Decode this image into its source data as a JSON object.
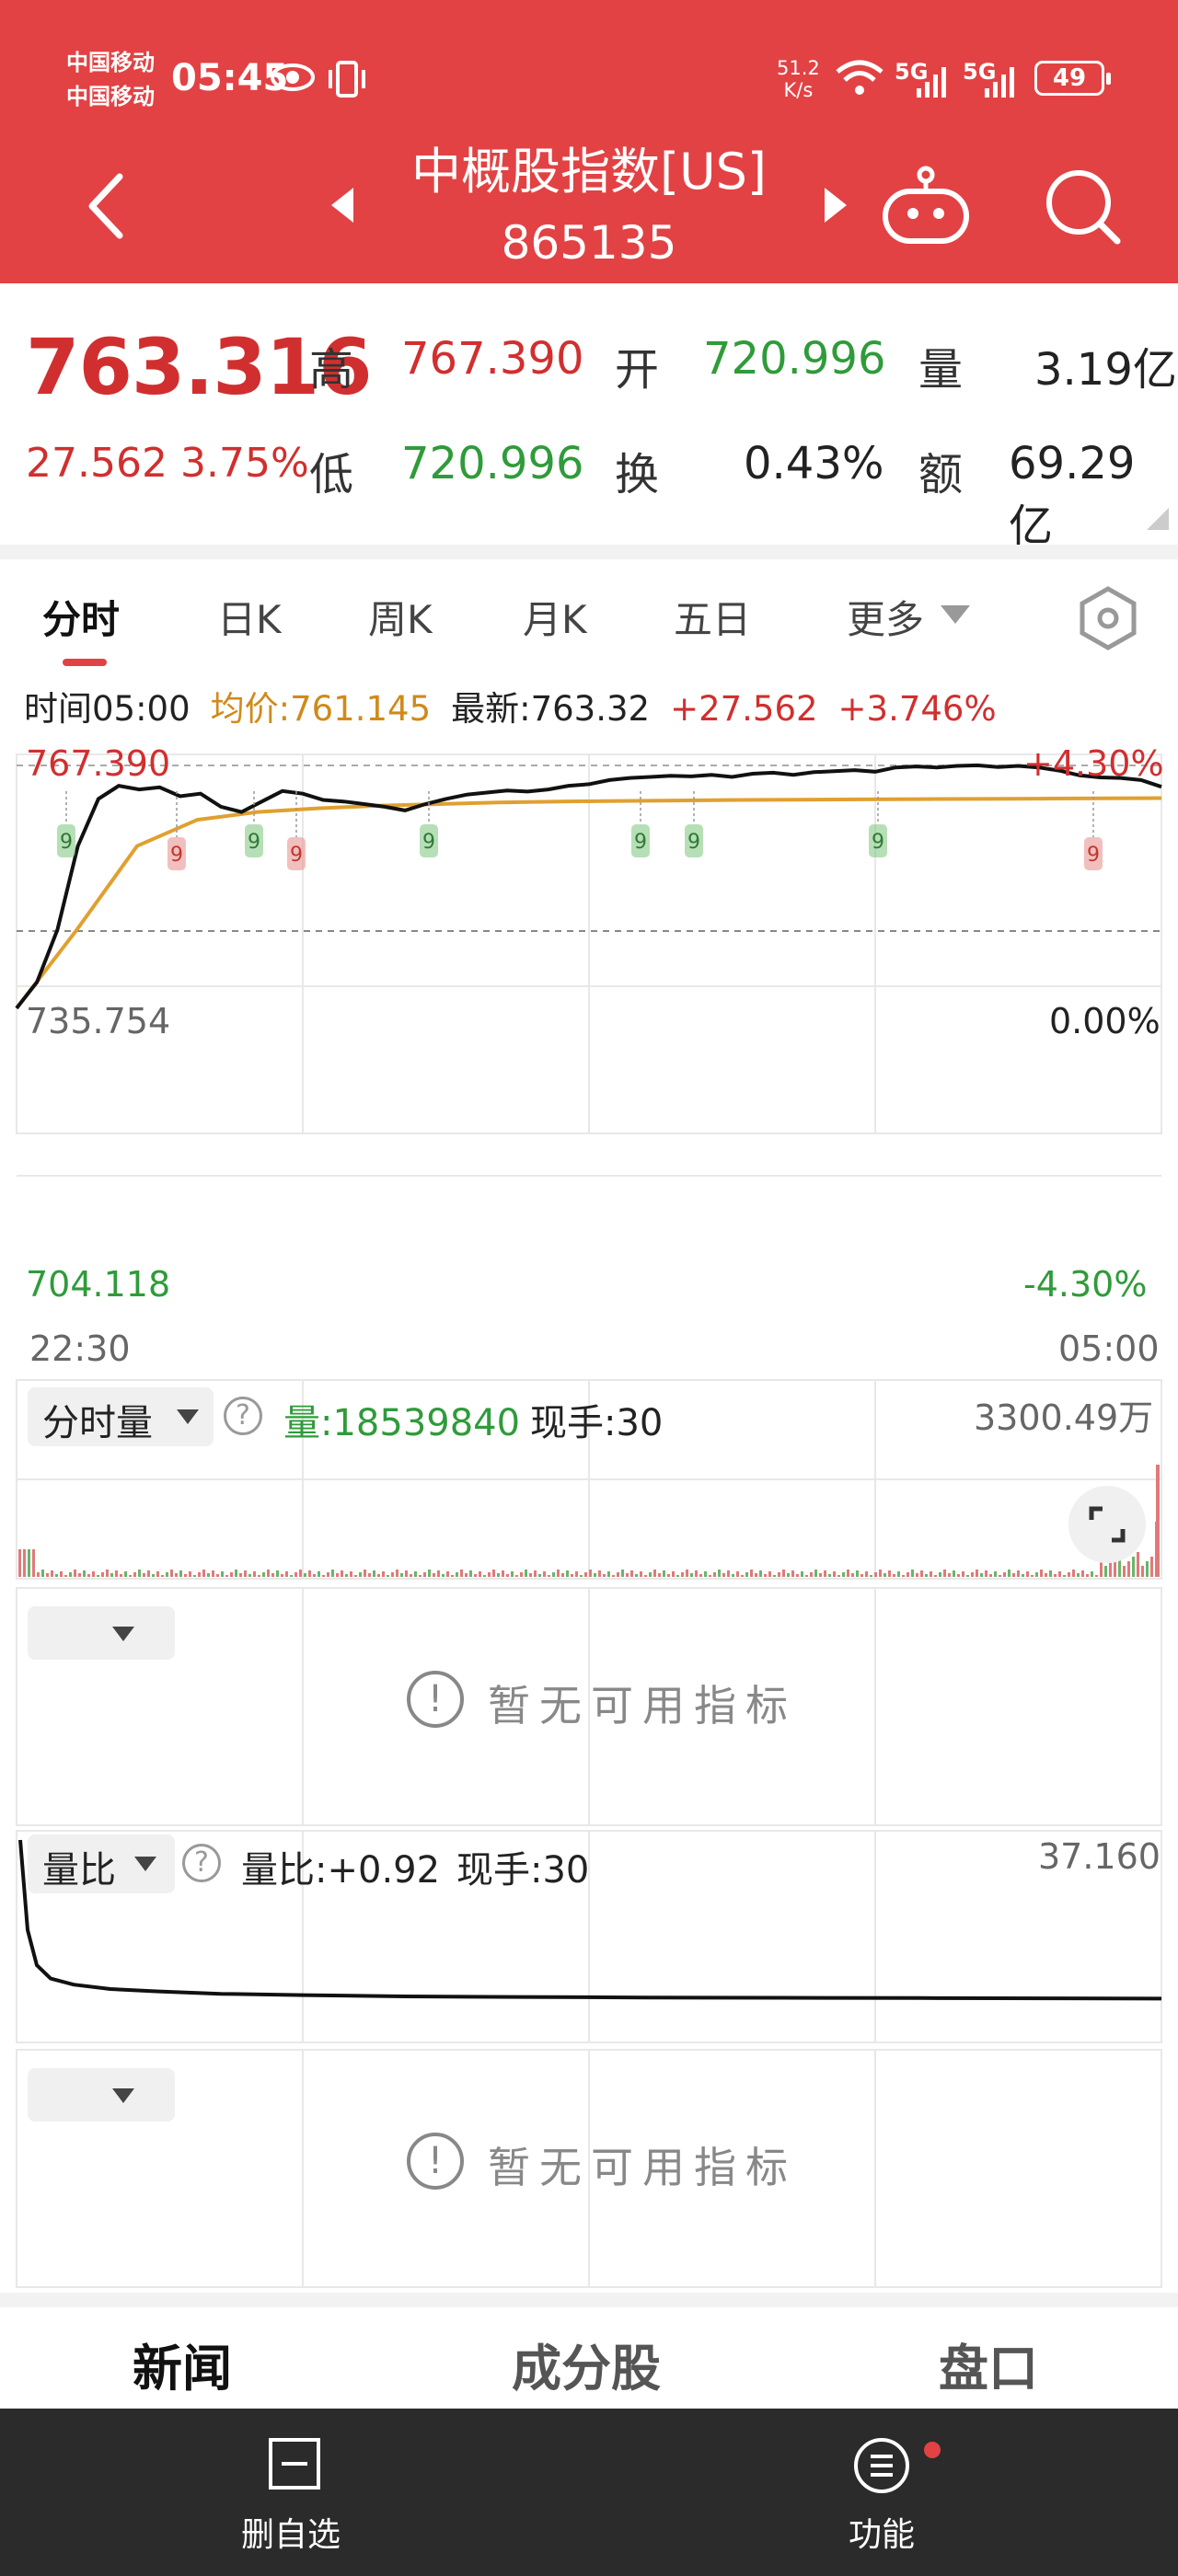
{
  "status_bar": {
    "carrier_1": "中国移动",
    "carrier_2": "中国移动",
    "time": "05:45",
    "speed_value": "51.2",
    "speed_unit": "K/s",
    "net_1": "5G",
    "net_2": "5G",
    "battery": "49"
  },
  "header": {
    "title": "中概股指数[US]",
    "code": "865135"
  },
  "quote": {
    "price": "763.316",
    "change": "27.562",
    "change_pct": "3.75%",
    "high_label": "高",
    "high_value": "767.390",
    "low_label": "低",
    "low_value": "720.996",
    "open_label": "开",
    "open_value": "720.996",
    "turnover_label": "换",
    "turnover_value": "0.43%",
    "volume_label": "量",
    "volume_value": "3.19亿",
    "amount_label": "额",
    "amount_value": "69.29亿"
  },
  "tabs": [
    "分时",
    "日K",
    "周K",
    "月K",
    "五日",
    "更多"
  ],
  "info_bar": {
    "time": "时间05:00",
    "avg": "均价:761.145",
    "latest": "最新:763.32",
    "change": "+27.562",
    "change_pct": "+3.746%"
  },
  "chart_data": [
    {
      "type": "line",
      "y_left_ticks": [
        "767.390",
        "735.754",
        "704.118"
      ],
      "y_right_ticks": [
        "+4.30%",
        "0.00%",
        "-4.30%"
      ],
      "x_ticks": [
        "22:30",
        "05:00"
      ],
      "ylim": [
        704.118,
        767.39
      ],
      "baseline": 735.754,
      "series": [
        {
          "name": "最新",
          "color": "#111111",
          "values": [
            721.0,
            726.0,
            736.0,
            752.0,
            761.0,
            763.5,
            762.8,
            763.2,
            761.5,
            762.0,
            759.5,
            758.5,
            760.5,
            762.5,
            762.0,
            760.8,
            760.5,
            760.0,
            759.5,
            758.8,
            760.0,
            761.0,
            761.8,
            762.2,
            762.6,
            762.4,
            762.8,
            763.5,
            763.8,
            764.6,
            765.0,
            765.2,
            765.4,
            765.3,
            765.6,
            765.2,
            765.8,
            766.0,
            765.6,
            766.1,
            766.3,
            766.5,
            766.2,
            767.0,
            767.2,
            767.0,
            767.3,
            767.4,
            767.1,
            767.3,
            767.0,
            766.4,
            765.5,
            765.1,
            765.0,
            764.6,
            763.32
          ]
        },
        {
          "name": "均价",
          "color": "#e0a030",
          "values": [
            721.0,
            736.0,
            752.0,
            757.0,
            758.5,
            759.2,
            759.7,
            760.0,
            760.3,
            760.5,
            760.6,
            760.7,
            760.8,
            760.85,
            760.9,
            760.95,
            761.0,
            761.05,
            761.1,
            761.145
          ]
        }
      ],
      "markers": [
        "9",
        "9",
        "9",
        "9",
        "9",
        "9",
        "9",
        "9",
        "9"
      ]
    },
    {
      "type": "bar",
      "title": "分时量",
      "labels": [
        "量:18539840",
        "现手:30"
      ],
      "ymax_label": "3300.49万"
    },
    {
      "type": "line",
      "title": "量比",
      "labels": [
        "量比:+0.92",
        "现手:30"
      ],
      "ymax_label": "37.160",
      "values": [
        37.16,
        6.0,
        2.6,
        1.8,
        1.5,
        1.3,
        1.2,
        1.1,
        1.05,
        1.0,
        0.98,
        0.96,
        0.95,
        0.94,
        0.93,
        0.92
      ]
    }
  ],
  "volume_panel": {
    "title": "分时量",
    "volume": "量:18539840",
    "hand": "现手:30",
    "max": "3300.49万"
  },
  "indicator_panel_1": {
    "text": "暂无可用指标"
  },
  "ratio_panel": {
    "title": "量比",
    "ratio": "量比:+0.92",
    "hand": "现手:30",
    "max": "37.160"
  },
  "indicator_panel_2": {
    "text": "暂无可用指标"
  },
  "bottom_tabs": [
    "新闻",
    "成分股",
    "盘口"
  ],
  "bottom_bar": {
    "delete": "删自选",
    "function": "功能"
  },
  "colors": {
    "header": "#e24244",
    "up": "#d12f2f",
    "down": "#2f9b3a",
    "avg_line": "#e0a030"
  }
}
